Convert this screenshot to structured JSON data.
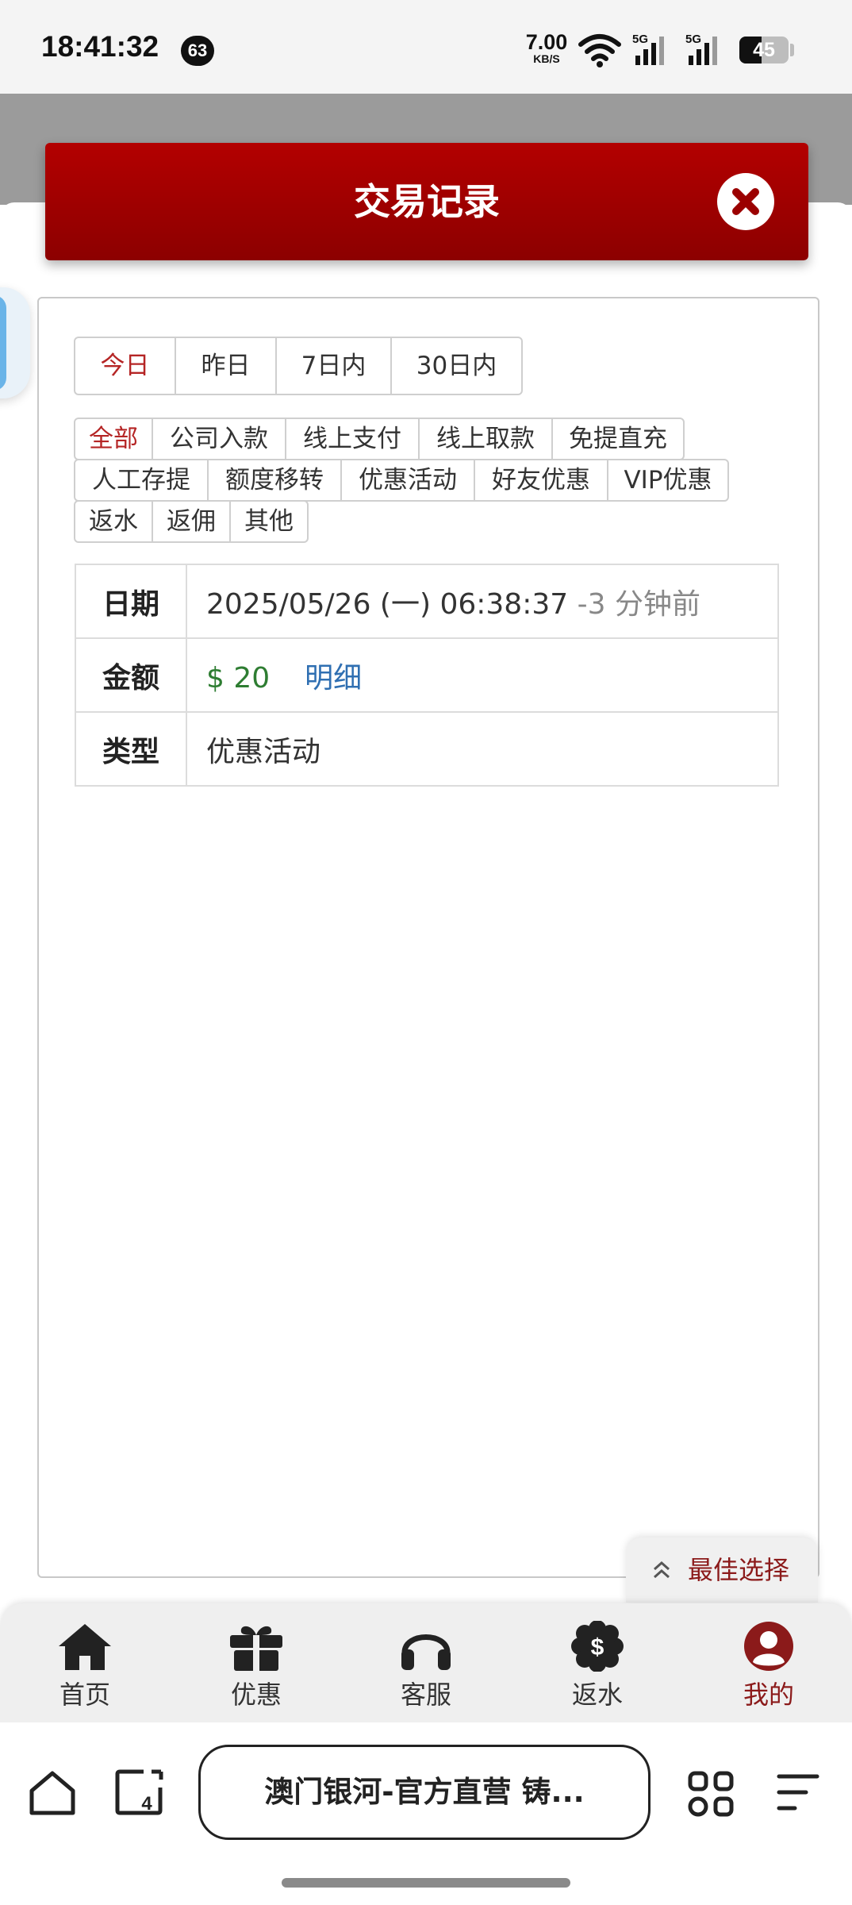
{
  "status_bar": {
    "time": "18:41:32",
    "notification_count": "63",
    "net_speed_value": "7.00",
    "net_speed_unit": "KB/S",
    "battery_level": "45",
    "battery_fraction": 0.45
  },
  "modal": {
    "title": "交易记录"
  },
  "date_filter": {
    "tabs": [
      "今日",
      "昨日",
      "7日内",
      "30日内"
    ],
    "active": "今日"
  },
  "type_filter": {
    "tags": [
      "全部",
      "公司入款",
      "线上支付",
      "线上取款",
      "免提直充",
      "人工存提",
      "额度移转",
      "优惠活动",
      "好友优惠",
      "VIP优惠",
      "返水",
      "返佣",
      "其他"
    ],
    "active": "全部"
  },
  "record": {
    "date_label": "日期",
    "date_value": "2025/05/26 (一) 06:38:37",
    "date_ago": "-3 分钟前",
    "amount_label": "金额",
    "amount_value": "$ 20",
    "detail_link": "明细",
    "type_label": "类型",
    "type_value": "优惠活动"
  },
  "best_choice": {
    "label": "最佳选择"
  },
  "bottom_nav": {
    "items": [
      {
        "label": "首页",
        "icon": "home-icon"
      },
      {
        "label": "优惠",
        "icon": "gift-icon"
      },
      {
        "label": "客服",
        "icon": "headset-icon"
      },
      {
        "label": "返水",
        "icon": "dollar-badge-icon"
      },
      {
        "label": "我的",
        "icon": "user-icon",
        "active": true
      }
    ]
  },
  "browser": {
    "tab_count": "4",
    "url_title": "澳门银河-官方直营 铸..."
  },
  "colors": {
    "header_red": "#b30000",
    "active_red": "#b52525",
    "money_green": "#2e7d32",
    "link_blue": "#2f6fb2",
    "nav_active": "#8b1a1a"
  }
}
